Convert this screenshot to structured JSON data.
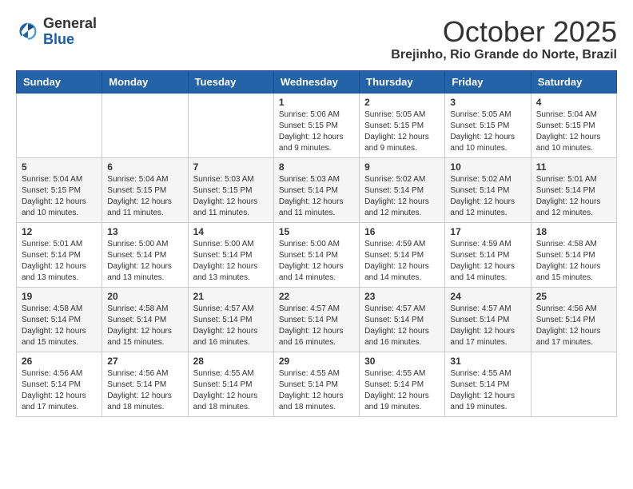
{
  "logo": {
    "general": "General",
    "blue": "Blue"
  },
  "title": {
    "month": "October 2025",
    "location": "Brejinho, Rio Grande do Norte, Brazil"
  },
  "weekdays": [
    "Sunday",
    "Monday",
    "Tuesday",
    "Wednesday",
    "Thursday",
    "Friday",
    "Saturday"
  ],
  "weeks": [
    [
      {
        "day": "",
        "info": ""
      },
      {
        "day": "",
        "info": ""
      },
      {
        "day": "",
        "info": ""
      },
      {
        "day": "1",
        "info": "Sunrise: 5:06 AM\nSunset: 5:15 PM\nDaylight: 12 hours\nand 9 minutes."
      },
      {
        "day": "2",
        "info": "Sunrise: 5:05 AM\nSunset: 5:15 PM\nDaylight: 12 hours\nand 9 minutes."
      },
      {
        "day": "3",
        "info": "Sunrise: 5:05 AM\nSunset: 5:15 PM\nDaylight: 12 hours\nand 10 minutes."
      },
      {
        "day": "4",
        "info": "Sunrise: 5:04 AM\nSunset: 5:15 PM\nDaylight: 12 hours\nand 10 minutes."
      }
    ],
    [
      {
        "day": "5",
        "info": "Sunrise: 5:04 AM\nSunset: 5:15 PM\nDaylight: 12 hours\nand 10 minutes."
      },
      {
        "day": "6",
        "info": "Sunrise: 5:04 AM\nSunset: 5:15 PM\nDaylight: 12 hours\nand 11 minutes."
      },
      {
        "day": "7",
        "info": "Sunrise: 5:03 AM\nSunset: 5:15 PM\nDaylight: 12 hours\nand 11 minutes."
      },
      {
        "day": "8",
        "info": "Sunrise: 5:03 AM\nSunset: 5:14 PM\nDaylight: 12 hours\nand 11 minutes."
      },
      {
        "day": "9",
        "info": "Sunrise: 5:02 AM\nSunset: 5:14 PM\nDaylight: 12 hours\nand 12 minutes."
      },
      {
        "day": "10",
        "info": "Sunrise: 5:02 AM\nSunset: 5:14 PM\nDaylight: 12 hours\nand 12 minutes."
      },
      {
        "day": "11",
        "info": "Sunrise: 5:01 AM\nSunset: 5:14 PM\nDaylight: 12 hours\nand 12 minutes."
      }
    ],
    [
      {
        "day": "12",
        "info": "Sunrise: 5:01 AM\nSunset: 5:14 PM\nDaylight: 12 hours\nand 13 minutes."
      },
      {
        "day": "13",
        "info": "Sunrise: 5:00 AM\nSunset: 5:14 PM\nDaylight: 12 hours\nand 13 minutes."
      },
      {
        "day": "14",
        "info": "Sunrise: 5:00 AM\nSunset: 5:14 PM\nDaylight: 12 hours\nand 13 minutes."
      },
      {
        "day": "15",
        "info": "Sunrise: 5:00 AM\nSunset: 5:14 PM\nDaylight: 12 hours\nand 14 minutes."
      },
      {
        "day": "16",
        "info": "Sunrise: 4:59 AM\nSunset: 5:14 PM\nDaylight: 12 hours\nand 14 minutes."
      },
      {
        "day": "17",
        "info": "Sunrise: 4:59 AM\nSunset: 5:14 PM\nDaylight: 12 hours\nand 14 minutes."
      },
      {
        "day": "18",
        "info": "Sunrise: 4:58 AM\nSunset: 5:14 PM\nDaylight: 12 hours\nand 15 minutes."
      }
    ],
    [
      {
        "day": "19",
        "info": "Sunrise: 4:58 AM\nSunset: 5:14 PM\nDaylight: 12 hours\nand 15 minutes."
      },
      {
        "day": "20",
        "info": "Sunrise: 4:58 AM\nSunset: 5:14 PM\nDaylight: 12 hours\nand 15 minutes."
      },
      {
        "day": "21",
        "info": "Sunrise: 4:57 AM\nSunset: 5:14 PM\nDaylight: 12 hours\nand 16 minutes."
      },
      {
        "day": "22",
        "info": "Sunrise: 4:57 AM\nSunset: 5:14 PM\nDaylight: 12 hours\nand 16 minutes."
      },
      {
        "day": "23",
        "info": "Sunrise: 4:57 AM\nSunset: 5:14 PM\nDaylight: 12 hours\nand 16 minutes."
      },
      {
        "day": "24",
        "info": "Sunrise: 4:57 AM\nSunset: 5:14 PM\nDaylight: 12 hours\nand 17 minutes."
      },
      {
        "day": "25",
        "info": "Sunrise: 4:56 AM\nSunset: 5:14 PM\nDaylight: 12 hours\nand 17 minutes."
      }
    ],
    [
      {
        "day": "26",
        "info": "Sunrise: 4:56 AM\nSunset: 5:14 PM\nDaylight: 12 hours\nand 17 minutes."
      },
      {
        "day": "27",
        "info": "Sunrise: 4:56 AM\nSunset: 5:14 PM\nDaylight: 12 hours\nand 18 minutes."
      },
      {
        "day": "28",
        "info": "Sunrise: 4:55 AM\nSunset: 5:14 PM\nDaylight: 12 hours\nand 18 minutes."
      },
      {
        "day": "29",
        "info": "Sunrise: 4:55 AM\nSunset: 5:14 PM\nDaylight: 12 hours\nand 18 minutes."
      },
      {
        "day": "30",
        "info": "Sunrise: 4:55 AM\nSunset: 5:14 PM\nDaylight: 12 hours\nand 19 minutes."
      },
      {
        "day": "31",
        "info": "Sunrise: 4:55 AM\nSunset: 5:14 PM\nDaylight: 12 hours\nand 19 minutes."
      },
      {
        "day": "",
        "info": ""
      }
    ]
  ]
}
